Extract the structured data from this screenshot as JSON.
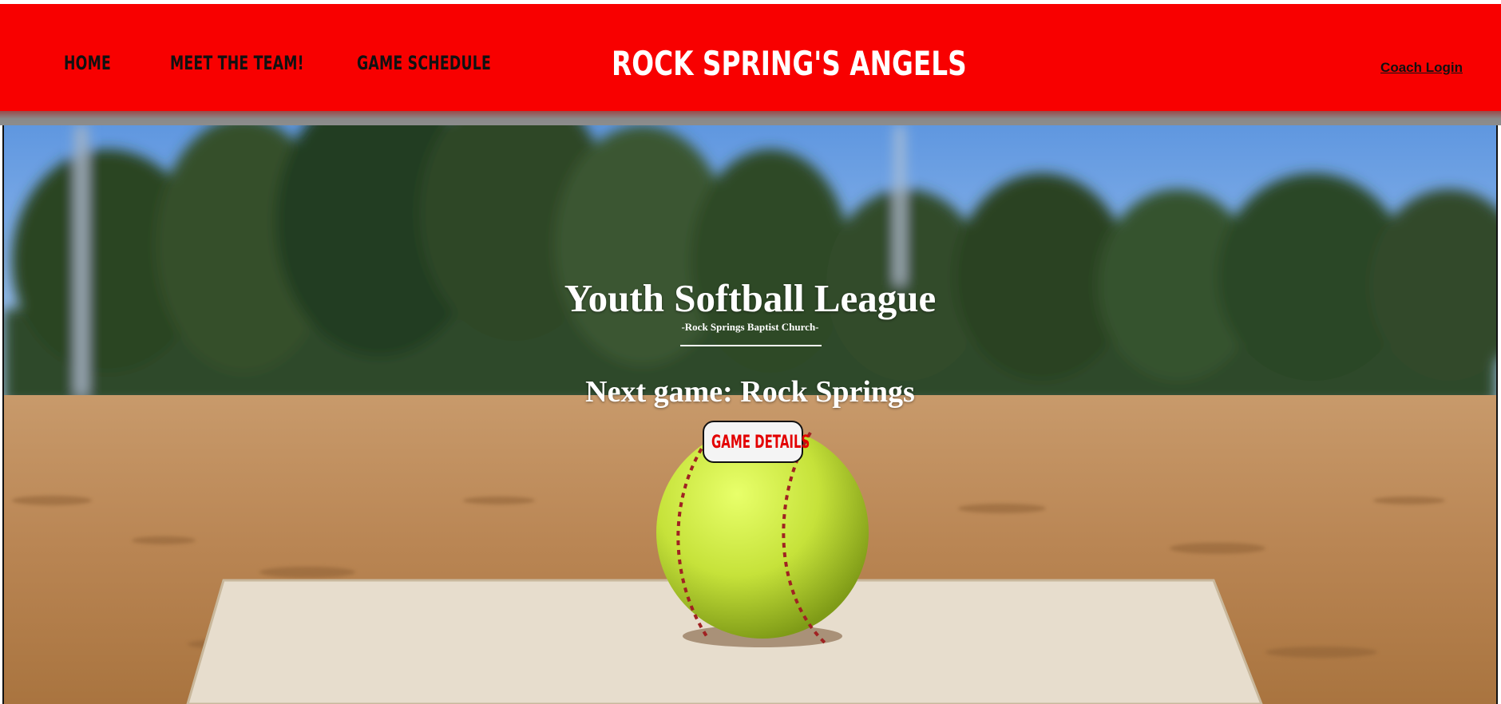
{
  "nav": {
    "home": "HOME",
    "team": "MEET THE TEAM!",
    "schedule": "GAME SCHEDULE"
  },
  "brand": {
    "name": "ROCK SPRING'S ANGELS"
  },
  "account": {
    "login": "Coach Login"
  },
  "hero": {
    "title": "Youth Softball League",
    "subtitle": "-Rock Springs Baptist Church-",
    "next_game": "Next game: Rock Springs",
    "details_button": "GAME DETAILS",
    "image": "softball-on-home-plate"
  },
  "colors": {
    "header": "#f80000",
    "button_text": "#e30000",
    "hero_text": "#ffffff"
  }
}
